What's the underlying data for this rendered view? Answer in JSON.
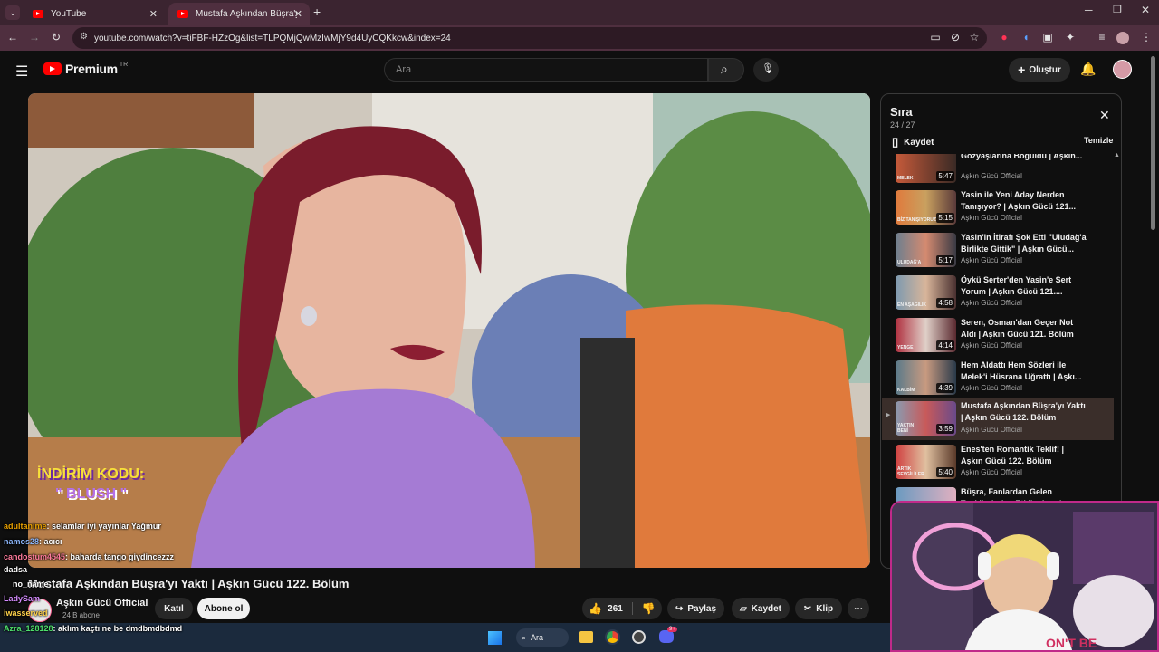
{
  "browser": {
    "tabs": [
      {
        "label": "YouTube",
        "active": false
      },
      {
        "label": "Mustafa Aşkından Büşra'yı Yaktı",
        "active": true
      }
    ],
    "new_tab_icon": "plus-icon",
    "url": "youtube.com/watch?v=tiFBF-HZzOg&list=TLPQMjQwMzIwMjY9d4UyCQKkcw&index=24"
  },
  "masthead": {
    "logo_text": "Premium",
    "logo_sup": "TR",
    "search_placeholder": "Ara",
    "create_label": "Oluştur"
  },
  "video": {
    "overlay_line1": "İNDİRİM KODU:",
    "overlay_line2": "\" BLUSH \"",
    "title": "Mustafa Aşkından Büşra'yı Yaktı | Aşkın Gücü 122. Bölüm"
  },
  "channel": {
    "name": "Aşkın Gücü Official",
    "subs": "24 B abone",
    "join_label": "Katıl",
    "subscribe_label": "Abone ol"
  },
  "actions": {
    "likes": "261",
    "share": "Paylaş",
    "save": "Kaydet",
    "clip": "Klip"
  },
  "queue": {
    "title": "Sıra",
    "position": "24 / 27",
    "save_label": "Kaydet",
    "clear_label": "Temizle",
    "items": [
      {
        "title": "Gözyaşlarına Boğuldu | Aşkın...",
        "channel": "Aşkın Gücü Official",
        "duration": "5:47",
        "tag": "MELEK"
      },
      {
        "title": "Yasin ile Yeni Aday Nerden Tanışıyor? | Aşkın Gücü 121...",
        "channel": "Aşkın Gücü Official",
        "duration": "5:15",
        "tag": "BİZ TANIŞIYORUZ"
      },
      {
        "title": "Yasin'in İtirafı Şok Etti \"Uludağ'a Birlikte Gittik\" | Aşkın Gücü...",
        "channel": "Aşkın Gücü Official",
        "duration": "5:17",
        "tag": "ULUDAĞ'A"
      },
      {
        "title": "Öykü Serter'den Yasin'e Sert Yorum | Aşkın Gücü 121....",
        "channel": "Aşkın Gücü Official",
        "duration": "4:58",
        "tag": "EN AŞAĞILIK"
      },
      {
        "title": "Seren, Osman'dan Geçer Not Aldı | Aşkın Gücü 121. Bölüm",
        "channel": "Aşkın Gücü Official",
        "duration": "4:14",
        "tag": "YENGE"
      },
      {
        "title": "Hem Aldattı Hem Sözleri ile Melek'i Hüsrana Uğrattı | Aşkı...",
        "channel": "Aşkın Gücü Official",
        "duration": "4:39",
        "tag": "KALBİM"
      },
      {
        "title": "Mustafa Aşkından Büşra'yı Yaktı | Aşkın Gücü 122. Bölüm",
        "channel": "Aşkın Gücü Official",
        "duration": "3:59",
        "tag": "YAKTIN BENİ"
      },
      {
        "title": "Enes'ten Romantik Teklif! | Aşkın Gücü 122. Bölüm",
        "channel": "Aşkın Gücü Official",
        "duration": "5:40",
        "tag": "ARTIK SEVGİLİLER"
      },
      {
        "title": "Büşra, Fanlardan Gelen Tepkilerinden Etkileniyor |",
        "channel": "",
        "duration": "",
        "tag": ""
      }
    ]
  },
  "chat": [
    {
      "user": "adultanime",
      "text": ": selamlar iyi yayınlar Yağmur",
      "color": "#e8a000"
    },
    {
      "user": "namos28",
      "text": ": acıcı",
      "color": "#8ab4f8"
    },
    {
      "user": "candostum4545",
      "text": ": baharda tango giydincezzz",
      "color": "#ff7b9c"
    },
    {
      "user": "dadsa",
      "text": "",
      "color": "#ffffff"
    },
    {
      "user": "no_name",
      "text": "",
      "color": "#ffffff"
    },
    {
      "user": "LadySam",
      "text": "",
      "color": "#d58cff"
    },
    {
      "user": "iwasserved",
      "text": "",
      "color": "#ffd24a"
    },
    {
      "user": "Azra_128128",
      "text": ": aklım kaçtı ne be dmdbmdbdmd",
      "color": "#4ee06b"
    }
  ],
  "taskbar": {
    "search_label": "Ara",
    "badge": "9+"
  }
}
